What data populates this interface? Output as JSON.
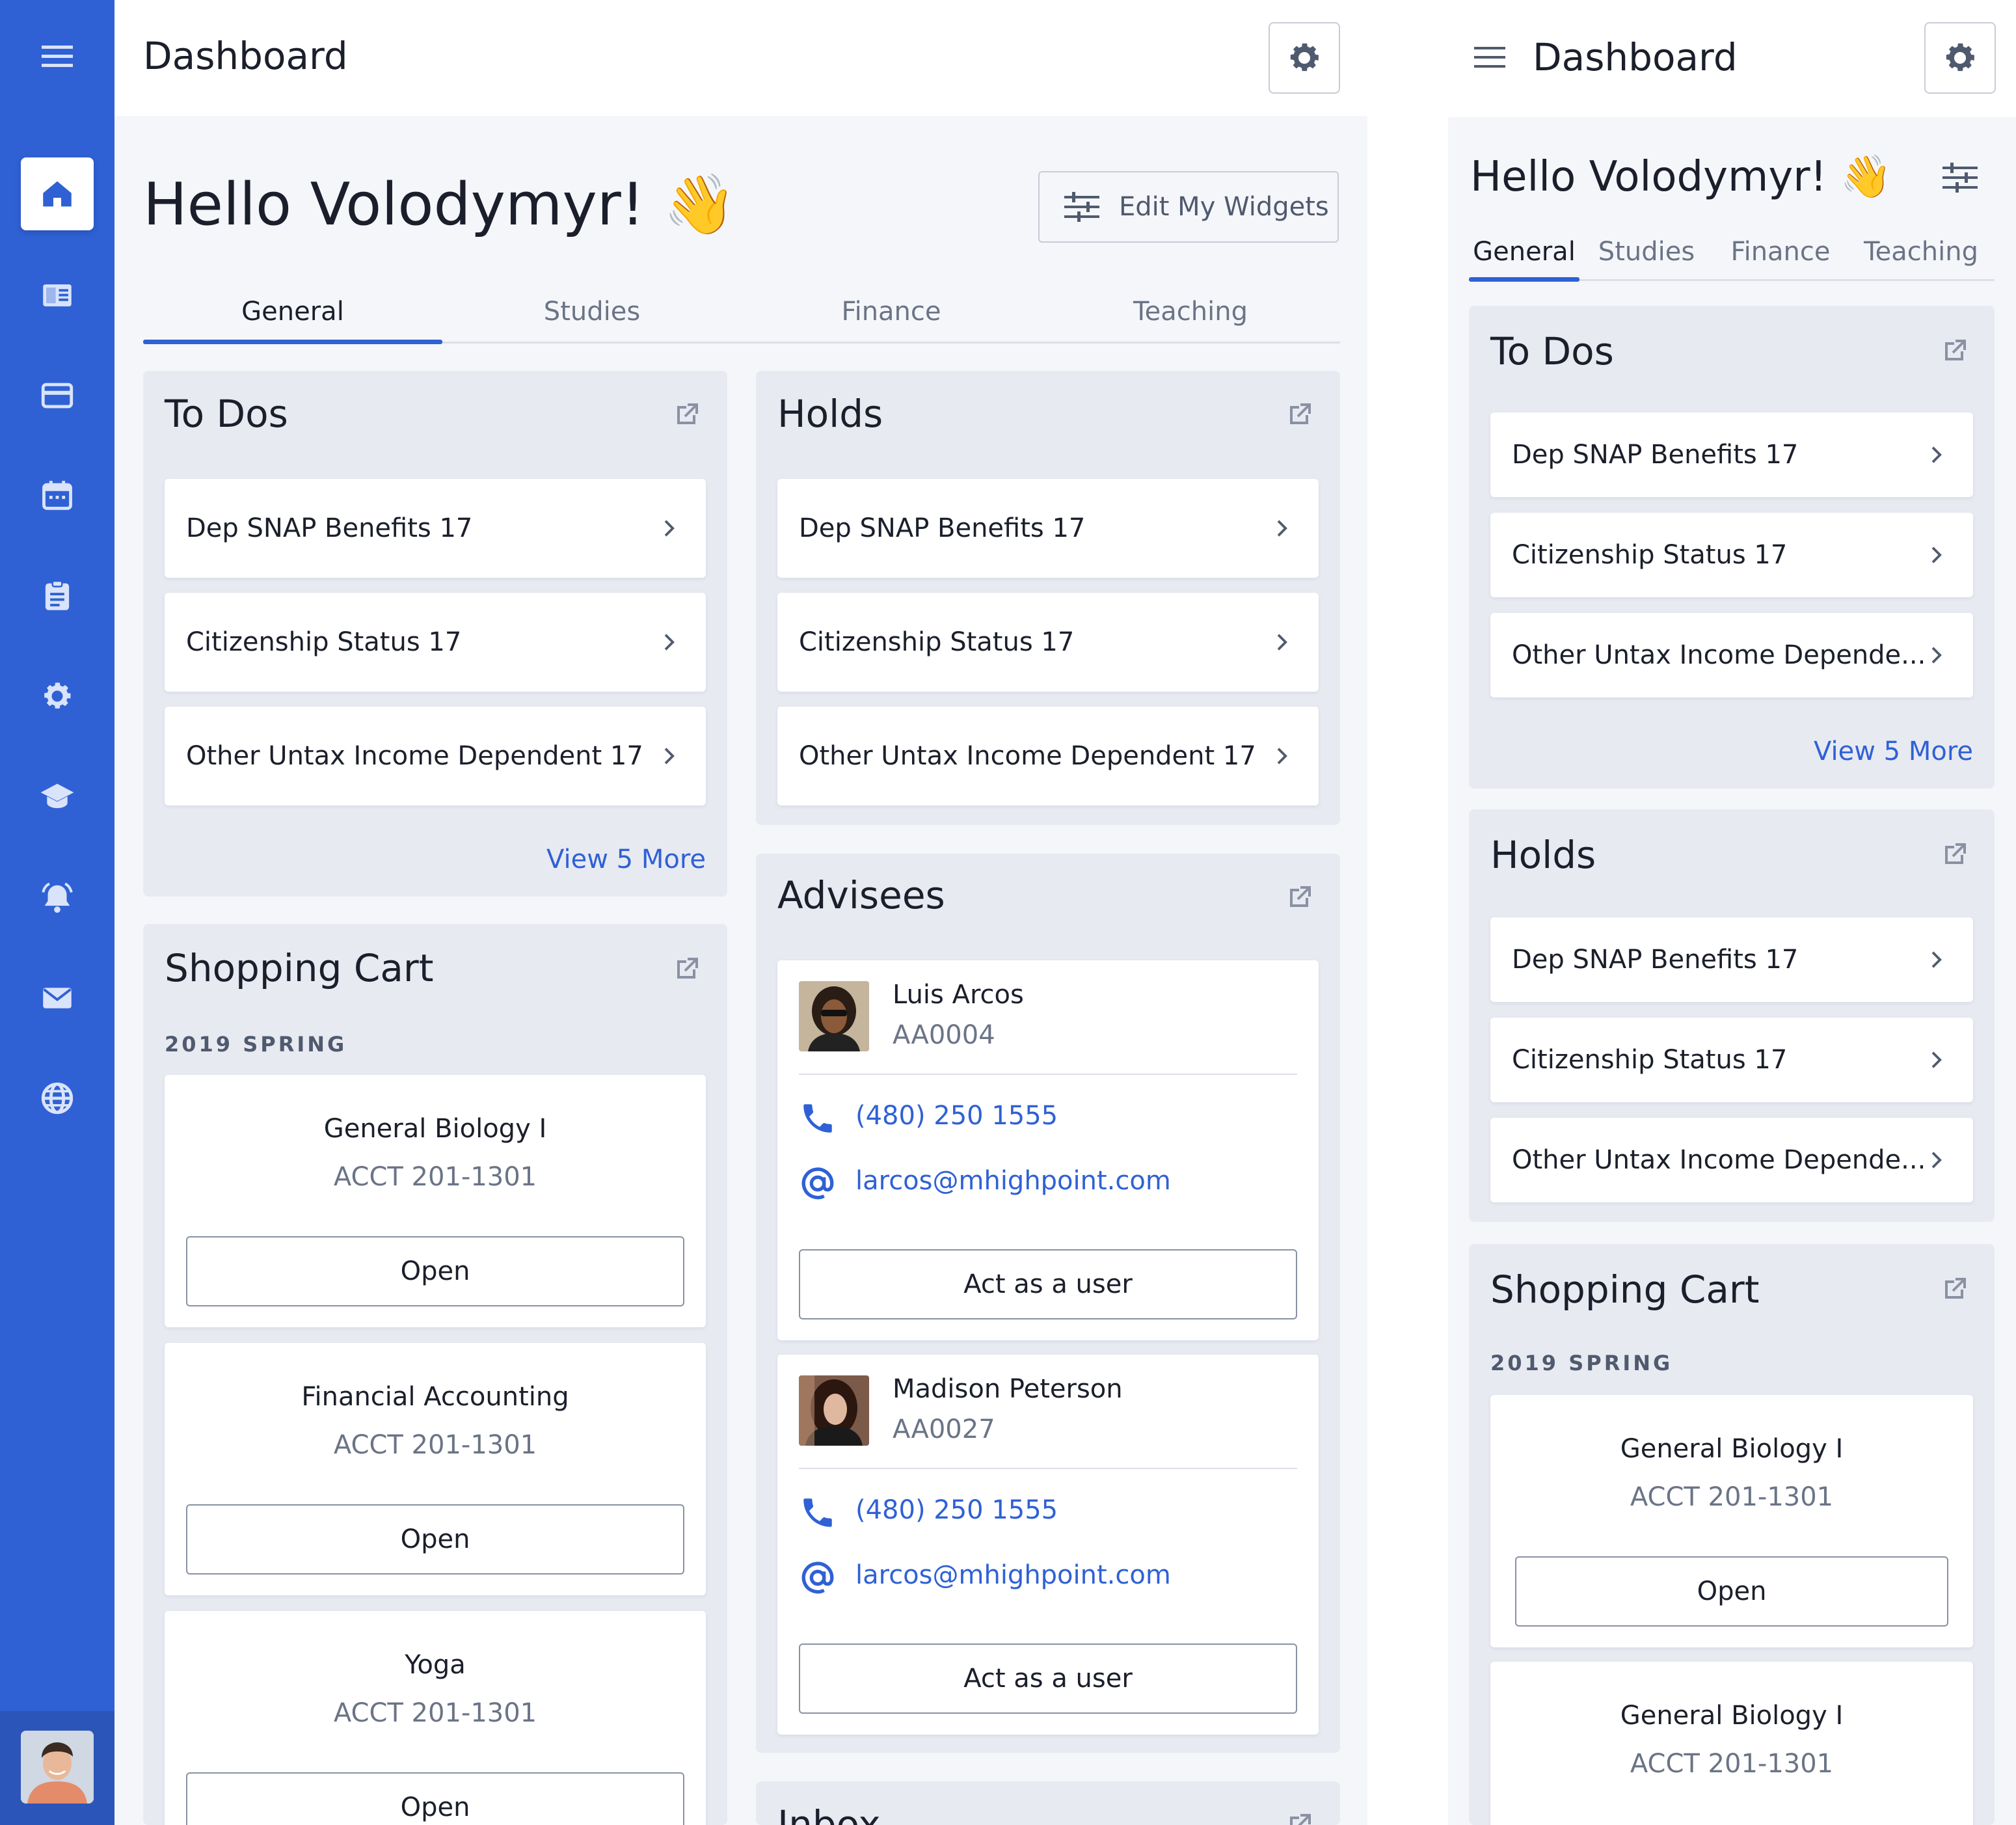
{
  "app": {
    "title": "Dashboard"
  },
  "greeting": "Hello Volodymyr!",
  "greeting_emoji": "👋",
  "edit_widgets_label": "Edit My Widgets",
  "tabs": [
    "General",
    "Studies",
    "Finance",
    "Teaching"
  ],
  "active_tab": "General",
  "colors": {
    "primary": "#2f61d5",
    "sidebar": "#2f61d5",
    "background": "#f5f6fa",
    "card": "#e8eaf2"
  },
  "sidebar": {
    "items": [
      {
        "icon": "home-icon",
        "active": true
      },
      {
        "icon": "newspaper-icon"
      },
      {
        "icon": "credit-card-icon"
      },
      {
        "icon": "calendar-icon"
      },
      {
        "icon": "clipboard-icon"
      },
      {
        "icon": "gear-icon"
      },
      {
        "icon": "graduation-cap-icon"
      },
      {
        "icon": "alarm-bell-icon"
      },
      {
        "icon": "mail-icon"
      },
      {
        "icon": "globe-icon"
      }
    ]
  },
  "todos": {
    "title": "To Dos",
    "items": [
      "Dep SNAP Benefits 17",
      "Citizenship Status 17",
      "Other Untax Income Dependent 17"
    ],
    "view_more": "View 5 More"
  },
  "holds": {
    "title": "Holds",
    "items": [
      "Dep SNAP Benefits 17",
      "Citizenship Status 17",
      "Other Untax Income Dependent 17"
    ]
  },
  "shopping_cart": {
    "title": "Shopping Cart",
    "term": "2019 SPRING",
    "courses": [
      {
        "name": "General Biology I",
        "code": "ACCT 201-1301",
        "button": "Open"
      },
      {
        "name": "Financial Accounting",
        "code": "ACCT 201-1301",
        "button": "Open"
      },
      {
        "name": "Yoga",
        "code": "ACCT 201-1301",
        "button": "Open"
      }
    ]
  },
  "advisees": {
    "title": "Advisees",
    "people": [
      {
        "name": "Luis Arcos",
        "id": "AA0004",
        "phone": "(480) 250 1555",
        "email": "larcos@mhighpoint.com",
        "button": "Act as a user"
      },
      {
        "name": "Madison Peterson",
        "id": "AA0027",
        "phone": "(480) 250 1555",
        "email": "larcos@mhighpoint.com",
        "button": "Act as a user"
      }
    ]
  },
  "inbox": {
    "title": "Inbox"
  },
  "mobile": {
    "todos_items": [
      "Dep SNAP Benefits 17",
      "Citizenship Status 17",
      "Other Untax Income Depende..."
    ],
    "holds_items": [
      "Dep SNAP Benefits 17",
      "Citizenship Status 17",
      "Other Untax Income Depende..."
    ],
    "cart_courses": [
      {
        "name": "General Biology I",
        "code": "ACCT 201-1301",
        "button": "Open"
      },
      {
        "name": "General Biology I",
        "code": "ACCT 201-1301"
      }
    ]
  }
}
